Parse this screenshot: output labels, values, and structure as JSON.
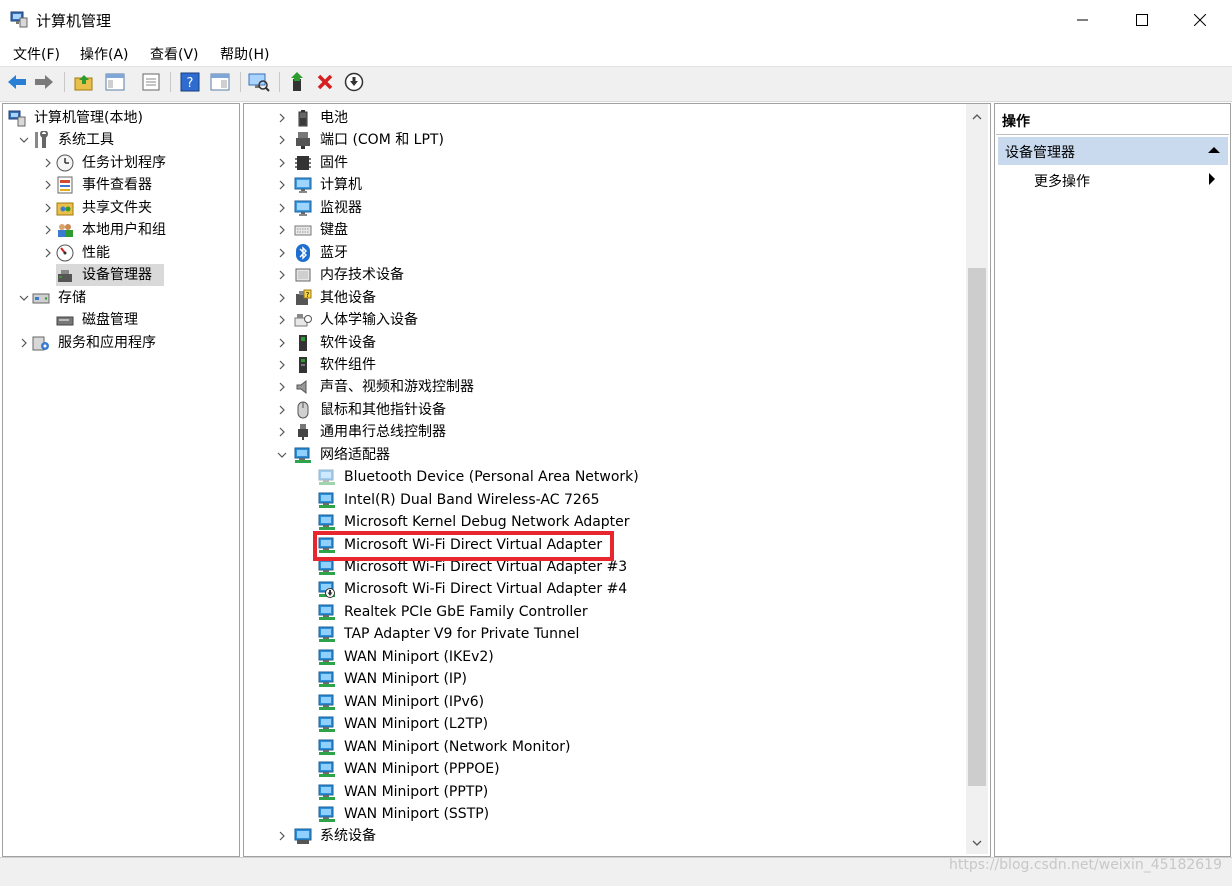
{
  "window": {
    "title": "计算机管理"
  },
  "menu": [
    "文件(F)",
    "操作(A)",
    "查看(V)",
    "帮助(H)"
  ],
  "left_tree": [
    {
      "label": "计算机管理(本地)",
      "icon": "computer-mgmt-icon",
      "level": 0,
      "chev": ""
    },
    {
      "label": "系统工具",
      "icon": "tools-icon",
      "level": 1,
      "chev": "down"
    },
    {
      "label": "任务计划程序",
      "icon": "clock-icon",
      "level": 2,
      "chev": "right"
    },
    {
      "label": "事件查看器",
      "icon": "event-viewer-icon",
      "level": 2,
      "chev": "right"
    },
    {
      "label": "共享文件夹",
      "icon": "shared-folder-icon",
      "level": 2,
      "chev": "right"
    },
    {
      "label": "本地用户和组",
      "icon": "users-icon",
      "level": 2,
      "chev": "right"
    },
    {
      "label": "性能",
      "icon": "performance-icon",
      "level": 2,
      "chev": "right"
    },
    {
      "label": "设备管理器",
      "icon": "device-manager-icon",
      "level": 2,
      "chev": "",
      "selected": true
    },
    {
      "label": "存储",
      "icon": "storage-icon",
      "level": 1,
      "chev": "down"
    },
    {
      "label": "磁盘管理",
      "icon": "disk-icon",
      "level": 2,
      "chev": ""
    },
    {
      "label": "服务和应用程序",
      "icon": "services-icon",
      "level": 1,
      "chev": "right"
    }
  ],
  "device_tree": [
    {
      "label": "电池",
      "icon": "battery-icon",
      "level": 0,
      "chev": "right"
    },
    {
      "label": "端口 (COM 和 LPT)",
      "icon": "port-icon",
      "level": 0,
      "chev": "right"
    },
    {
      "label": "固件",
      "icon": "firmware-icon",
      "level": 0,
      "chev": "right"
    },
    {
      "label": "计算机",
      "icon": "monitor-icon",
      "level": 0,
      "chev": "right"
    },
    {
      "label": "监视器",
      "icon": "monitor-icon",
      "level": 0,
      "chev": "right"
    },
    {
      "label": "键盘",
      "icon": "keyboard-icon",
      "level": 0,
      "chev": "right"
    },
    {
      "label": "蓝牙",
      "icon": "bluetooth-icon",
      "level": 0,
      "chev": "right"
    },
    {
      "label": "内存技术设备",
      "icon": "memory-icon",
      "level": 0,
      "chev": "right"
    },
    {
      "label": "其他设备",
      "icon": "unknown-device-icon",
      "level": 0,
      "chev": "right"
    },
    {
      "label": "人体学输入设备",
      "icon": "hid-icon",
      "level": 0,
      "chev": "right"
    },
    {
      "label": "软件设备",
      "icon": "software-device-icon",
      "level": 0,
      "chev": "right"
    },
    {
      "label": "软件组件",
      "icon": "software-component-icon",
      "level": 0,
      "chev": "right"
    },
    {
      "label": "声音、视频和游戏控制器",
      "icon": "speaker-icon",
      "level": 0,
      "chev": "right"
    },
    {
      "label": "鼠标和其他指针设备",
      "icon": "mouse-icon",
      "level": 0,
      "chev": "right"
    },
    {
      "label": "通用串行总线控制器",
      "icon": "usb-icon",
      "level": 0,
      "chev": "right"
    },
    {
      "label": "网络适配器",
      "icon": "network-adapter-icon",
      "level": 0,
      "chev": "down"
    },
    {
      "label": "Bluetooth Device (Personal Area Network)",
      "icon": "network-adapter-icon",
      "level": 1,
      "chev": "",
      "faded": true
    },
    {
      "label": "Intel(R) Dual Band Wireless-AC 7265",
      "icon": "network-adapter-icon",
      "level": 1,
      "chev": ""
    },
    {
      "label": "Microsoft Kernel Debug Network Adapter",
      "icon": "network-adapter-icon",
      "level": 1,
      "chev": ""
    },
    {
      "label": "Microsoft Wi-Fi Direct Virtual Adapter",
      "icon": "network-adapter-icon",
      "level": 1,
      "chev": "",
      "highlight": true
    },
    {
      "label": "Microsoft Wi-Fi Direct Virtual Adapter #3",
      "icon": "network-adapter-icon",
      "level": 1,
      "chev": ""
    },
    {
      "label": "Microsoft Wi-Fi Direct Virtual Adapter #4",
      "icon": "network-adapter-disabled-icon",
      "level": 1,
      "chev": ""
    },
    {
      "label": "Realtek PCIe GbE Family Controller",
      "icon": "network-adapter-icon",
      "level": 1,
      "chev": ""
    },
    {
      "label": "TAP Adapter V9 for Private Tunnel",
      "icon": "network-adapter-icon",
      "level": 1,
      "chev": ""
    },
    {
      "label": "WAN Miniport (IKEv2)",
      "icon": "network-adapter-icon",
      "level": 1,
      "chev": ""
    },
    {
      "label": "WAN Miniport (IP)",
      "icon": "network-adapter-icon",
      "level": 1,
      "chev": ""
    },
    {
      "label": "WAN Miniport (IPv6)",
      "icon": "network-adapter-icon",
      "level": 1,
      "chev": ""
    },
    {
      "label": "WAN Miniport (L2TP)",
      "icon": "network-adapter-icon",
      "level": 1,
      "chev": ""
    },
    {
      "label": "WAN Miniport (Network Monitor)",
      "icon": "network-adapter-icon",
      "level": 1,
      "chev": ""
    },
    {
      "label": "WAN Miniport (PPPOE)",
      "icon": "network-adapter-icon",
      "level": 1,
      "chev": ""
    },
    {
      "label": "WAN Miniport (PPTP)",
      "icon": "network-adapter-icon",
      "level": 1,
      "chev": ""
    },
    {
      "label": "WAN Miniport (SSTP)",
      "icon": "network-adapter-icon",
      "level": 1,
      "chev": ""
    },
    {
      "label": "系统设备",
      "icon": "system-device-icon",
      "level": 0,
      "chev": "right"
    }
  ],
  "actions": {
    "header": "操作",
    "section": "设备管理器",
    "more": "更多操作"
  },
  "watermark": "https://blog.csdn.net/weixin_45182619",
  "colors": {
    "highlight": "#e8262e",
    "selected_bg": "#d9d9d9",
    "actions_section_bg": "#c9d9ee"
  }
}
